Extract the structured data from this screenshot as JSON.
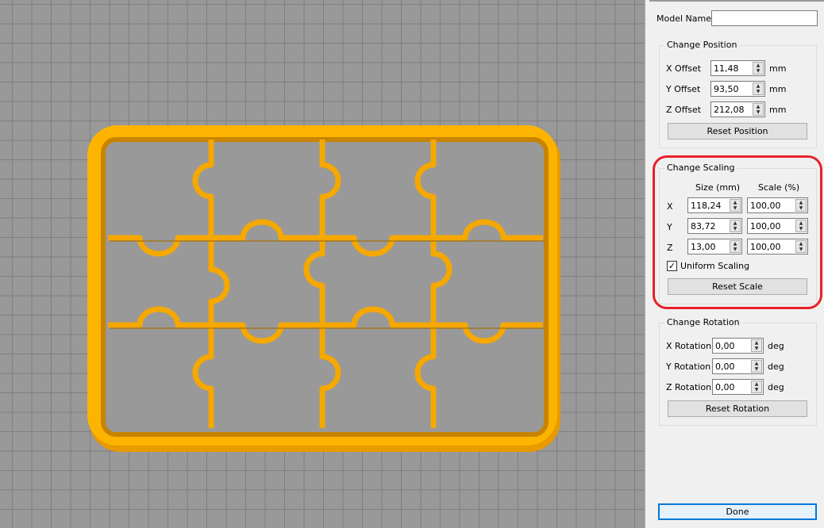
{
  "viewport": {
    "model_color": "#f5a800",
    "background": "#999999"
  },
  "panel": {
    "model_name_label": "Model Name:",
    "model_name_value": "",
    "position": {
      "title": "Change Position",
      "rows": [
        {
          "label": "X Offset",
          "value": "11,48",
          "unit": "mm"
        },
        {
          "label": "Y Offset",
          "value": "93,50",
          "unit": "mm"
        },
        {
          "label": "Z Offset",
          "value": "212,08",
          "unit": "mm"
        }
      ],
      "reset": "Reset Position"
    },
    "scaling": {
      "title": "Change Scaling",
      "size_header": "Size (mm)",
      "scale_header": "Scale (%)",
      "rows": [
        {
          "label": "X",
          "size": "118,24",
          "scale": "100,00"
        },
        {
          "label": "Y",
          "size": "83,72",
          "scale": "100,00"
        },
        {
          "label": "Z",
          "size": "13,00",
          "scale": "100,00"
        }
      ],
      "uniform_label": "Uniform Scaling",
      "uniform_checked": true,
      "reset": "Reset Scale"
    },
    "rotation": {
      "title": "Change Rotation",
      "rows": [
        {
          "label": "X Rotation",
          "value": "0,00",
          "unit": "deg"
        },
        {
          "label": "Y Rotation",
          "value": "0,00",
          "unit": "deg"
        },
        {
          "label": "Z Rotation",
          "value": "0,00",
          "unit": "deg"
        }
      ],
      "reset": "Reset Rotation"
    },
    "done": "Done",
    "highlight_color": "#e8202a"
  }
}
